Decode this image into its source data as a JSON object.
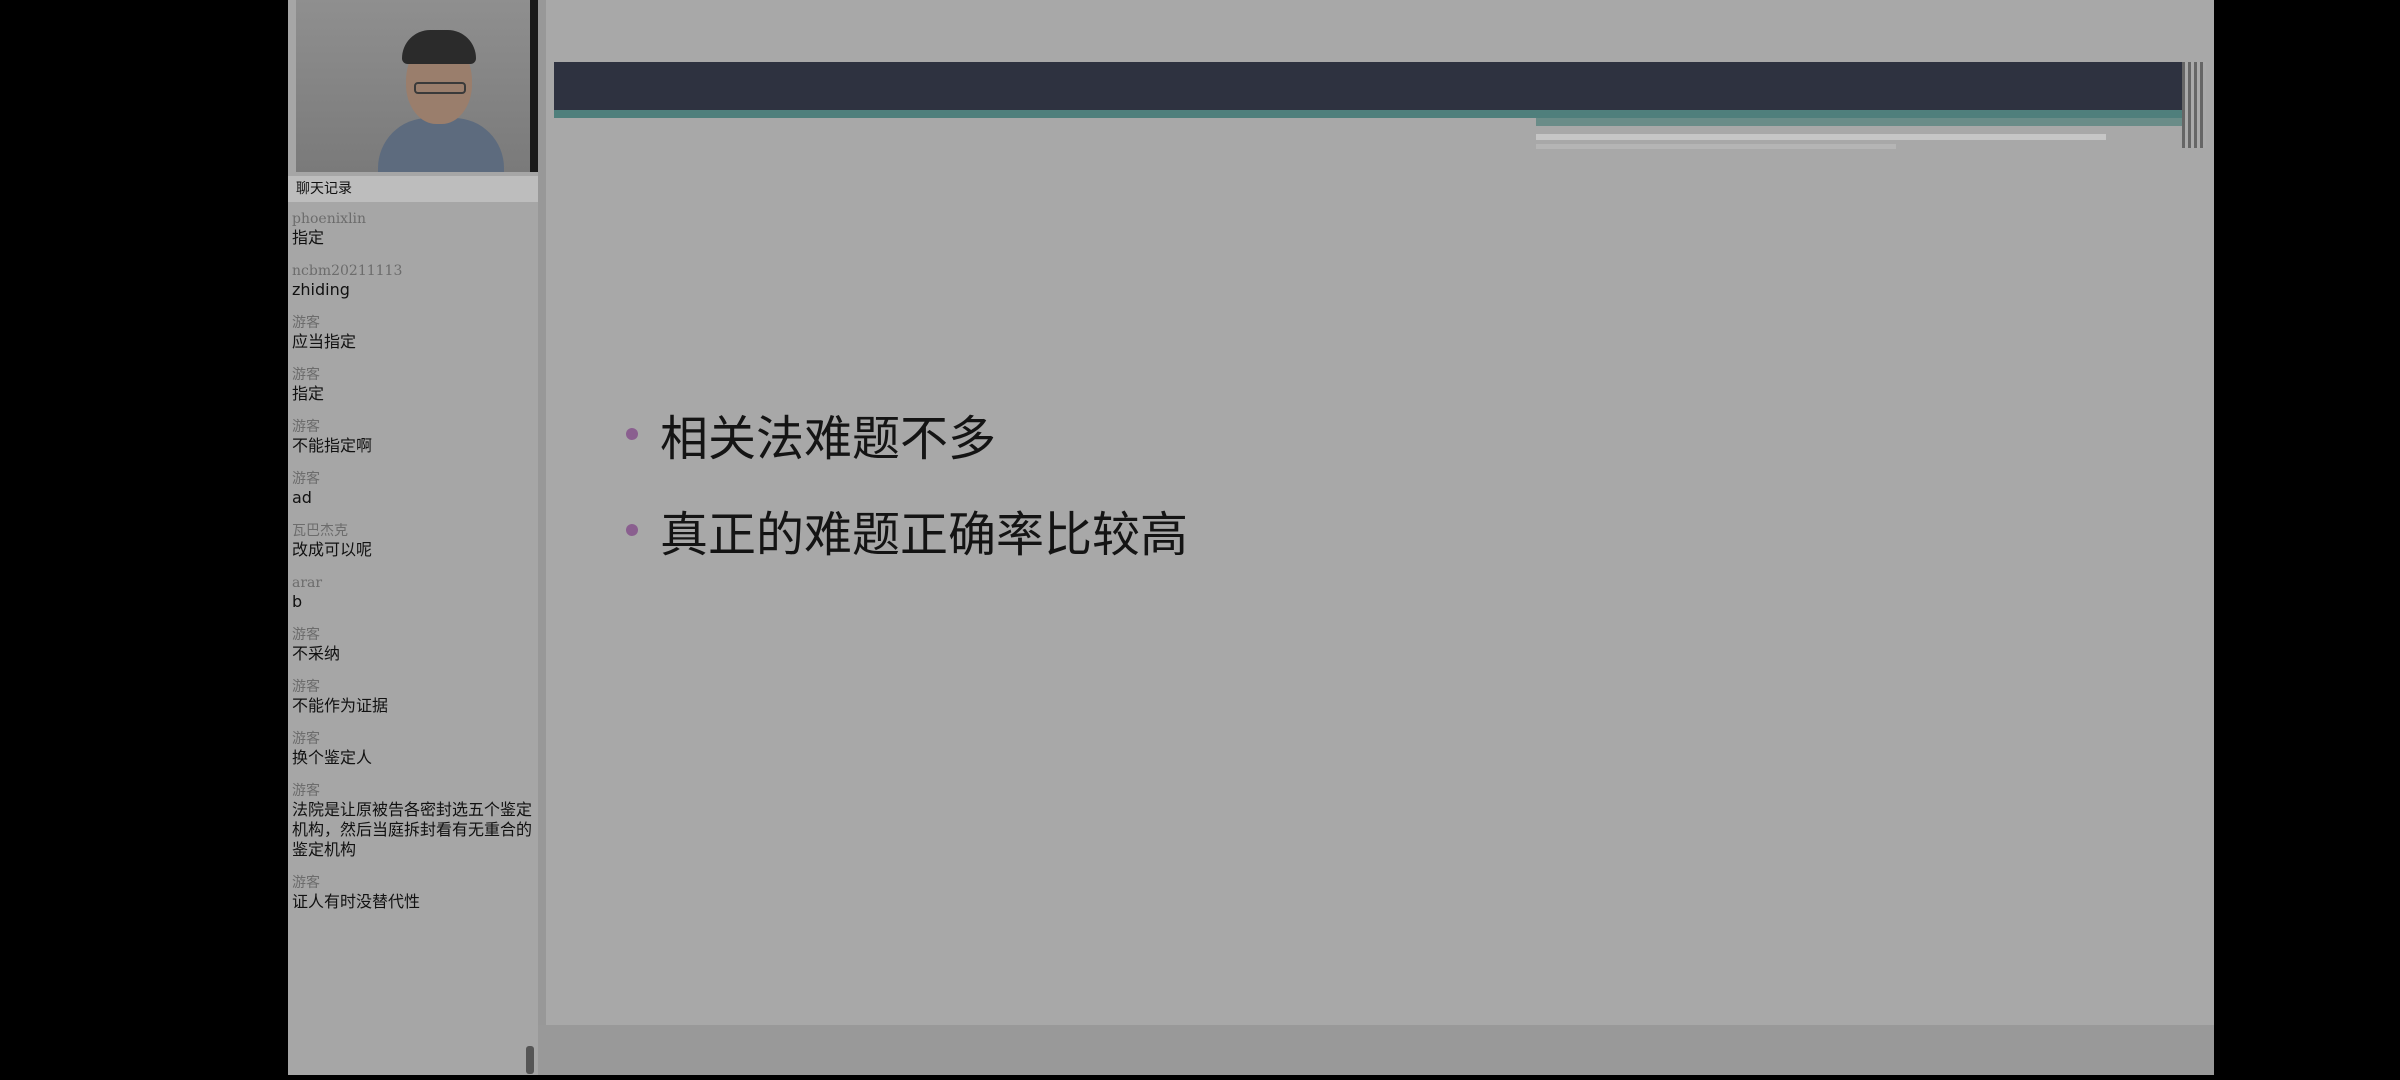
{
  "chat": {
    "header": "聊天记录",
    "messages": [
      {
        "user": "phoenixlin",
        "text": "指定"
      },
      {
        "user": "ncbm20211113",
        "text": "zhiding"
      },
      {
        "user": "游客",
        "text": "应当指定"
      },
      {
        "user": "游客",
        "text": "指定"
      },
      {
        "user": "游客",
        "text": "不能指定啊"
      },
      {
        "user": "游客",
        "text": "ad"
      },
      {
        "user": "瓦巴杰克",
        "text": "改成可以呢"
      },
      {
        "user": "arar",
        "text": "b"
      },
      {
        "user": "游客",
        "text": "不采纳"
      },
      {
        "user": "游客",
        "text": "不能作为证据"
      },
      {
        "user": "游客",
        "text": "换个鉴定人"
      },
      {
        "user": "游客",
        "text": "法院是让原被告各密封选五个鉴定机构，然后当庭拆封看有无重合的鉴定机构"
      },
      {
        "user": "游客",
        "text": "证人有时没替代性"
      }
    ]
  },
  "slide": {
    "bullets": [
      "相关法难题不多",
      "真正的难题正确率比较高"
    ],
    "colors": {
      "header_dark": "#2e3240",
      "header_teal": "#4f7f7c",
      "bullet": "#8a5f8f"
    }
  }
}
